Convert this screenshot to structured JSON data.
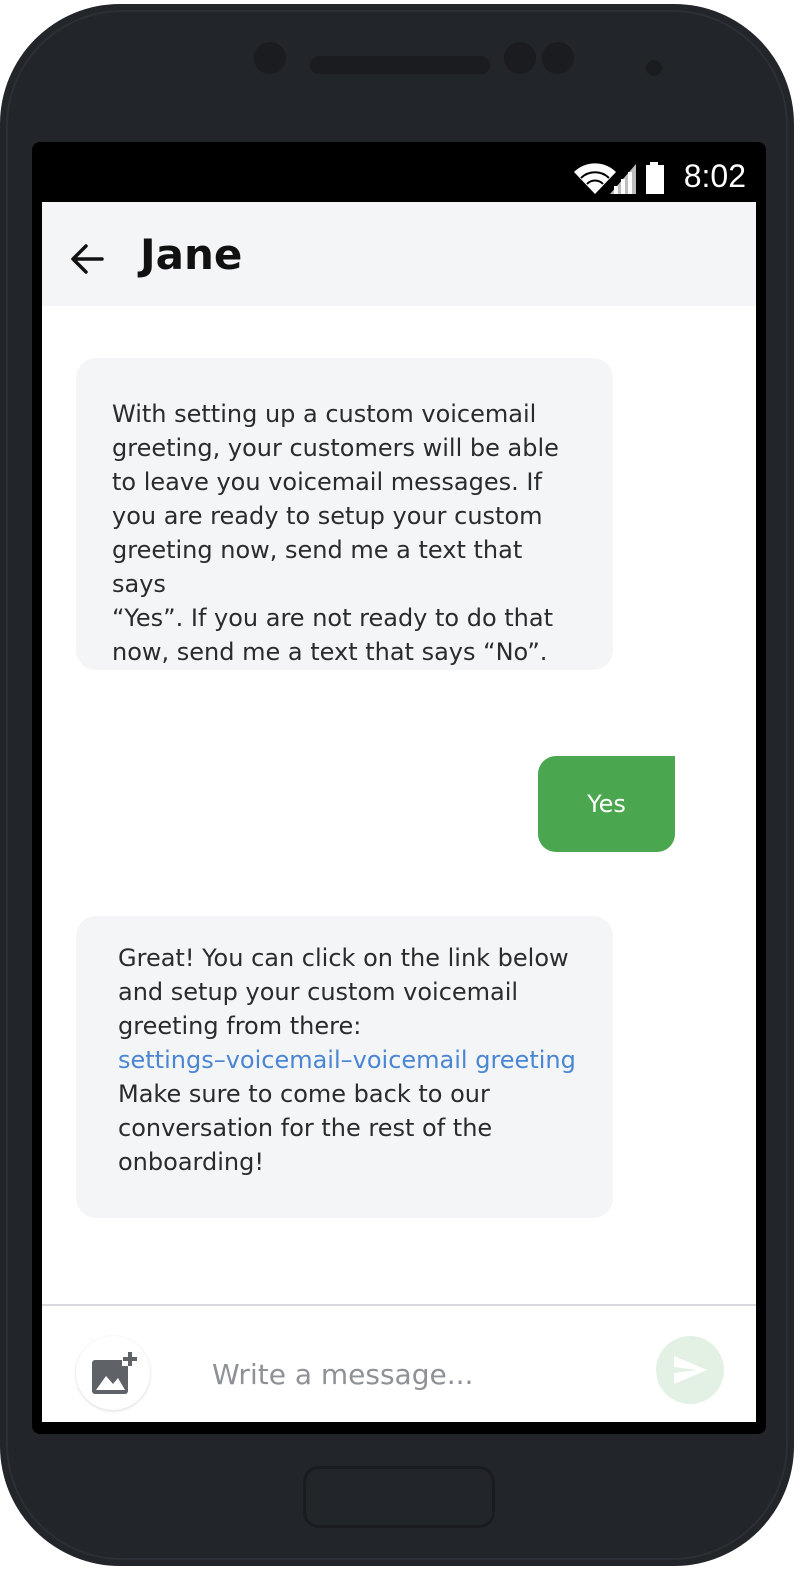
{
  "status_bar": {
    "time": "8:02",
    "icons": [
      "wifi-icon",
      "signal-icon",
      "battery-icon"
    ]
  },
  "header": {
    "title": "Jane",
    "back_icon": "arrow-left-icon"
  },
  "messages": [
    {
      "direction": "incoming",
      "lines": [
        "With setting up a custom voicemail",
        "greeting, your customers will be able",
        "to leave you voicemail messages. If",
        "you are ready to setup your custom",
        "greeting now, send me a text that says",
        "“Yes”. If you are not ready to do that",
        "now, send me a text that says “No”."
      ]
    },
    {
      "direction": "outgoing",
      "text": "Yes"
    },
    {
      "direction": "incoming",
      "lines_before": [
        "Great! You can click on the link below",
        "and setup your custom voicemail",
        "greeting from there:"
      ],
      "link": "settings–voicemail–voicemail greeting",
      "lines_after": [
        "Make sure to come back to our",
        "conversation for the rest of the",
        "onboarding!"
      ]
    }
  ],
  "composer": {
    "placeholder": "Write a message...",
    "attach_icon": "add-photo-icon",
    "send_icon": "send-icon"
  },
  "colors": {
    "outgoing_bubble": "#4aa64f",
    "incoming_bubble": "#f4f5f7",
    "link": "#4a86d4",
    "send_button": "#e3f1e4"
  }
}
